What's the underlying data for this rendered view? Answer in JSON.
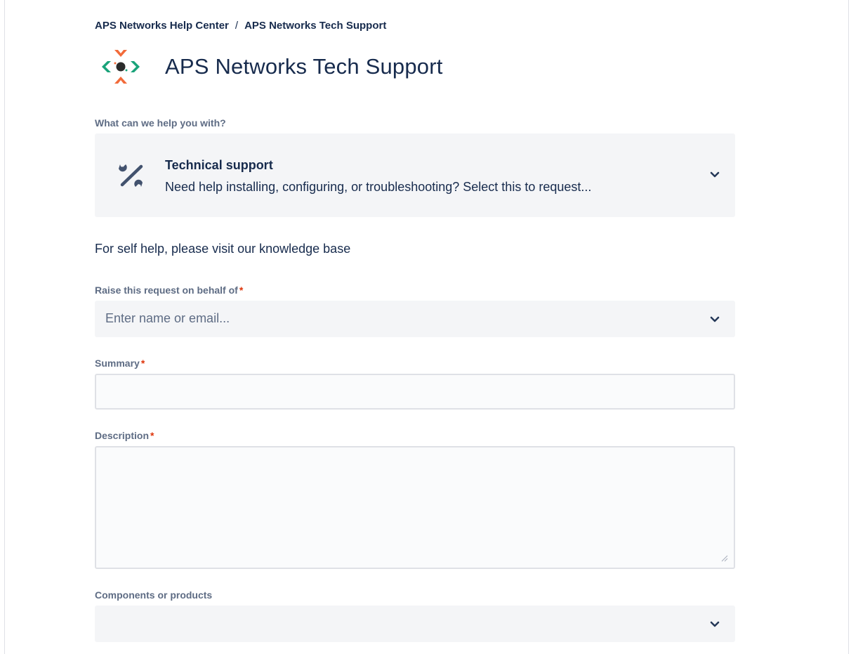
{
  "breadcrumb": {
    "items": [
      "APS Networks Help Center",
      "APS Networks Tech Support"
    ],
    "separator": "/"
  },
  "header": {
    "title": "APS Networks Tech Support",
    "logo_colors": {
      "orange": "#f26b3a",
      "green": "#1aa37a",
      "dark": "#2b2b2b"
    }
  },
  "request_type": {
    "label": "What can we help you with?",
    "selected_title": "Technical support",
    "selected_description": "Need help installing, configuring, or troubleshooting? Select this to request...",
    "icon": "tools-icon"
  },
  "self_help": "For self help, please visit our knowledge base",
  "fields": {
    "on_behalf": {
      "label": "Raise this request on behalf of",
      "required_mark": "*",
      "placeholder": "Enter name or email..."
    },
    "summary": {
      "label": "Summary",
      "required_mark": "*",
      "value": ""
    },
    "description": {
      "label": "Description",
      "required_mark": "*",
      "value": ""
    },
    "components": {
      "label": "Components or products",
      "value": ""
    }
  },
  "colors": {
    "text_primary": "#172b4d",
    "label": "#5e6c84",
    "required": "#de350b",
    "field_bg": "#f4f5f7",
    "border": "#dfe1e6"
  }
}
